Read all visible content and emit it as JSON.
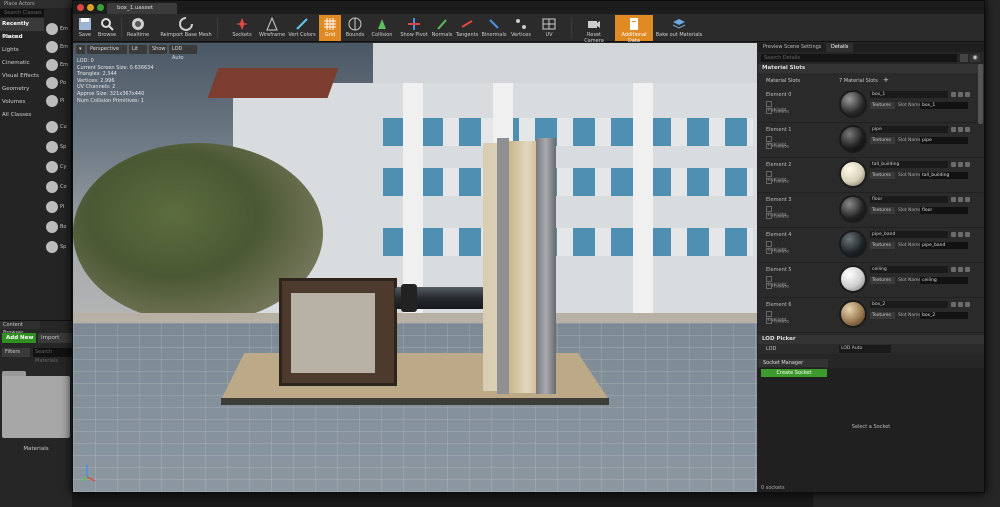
{
  "left": {
    "header": "Place Actors",
    "search_placeholder": "Search Classes",
    "categories": [
      "Recently Placed",
      "Basic",
      "Lights",
      "Cinematic",
      "Visual Effects",
      "Geometry",
      "Volumes",
      "All Classes"
    ],
    "actors": [
      "Em",
      "Em",
      "Em",
      "Po",
      "Pl",
      "Cu",
      "Sp",
      "Cy",
      "Co",
      "Pl",
      "Bo",
      "Sp"
    ]
  },
  "content_browser": {
    "tab": "Content Browser",
    "add_new": "Add New",
    "import": "Import",
    "filters": "Filters",
    "search_placeholder": "Search Materials",
    "folder_label": "Materials"
  },
  "window": {
    "tab_title": "box_1.uasset"
  },
  "toolbar": {
    "items": [
      "Save",
      "Browse",
      "Realtime",
      "Reimport Base Mesh",
      "Sockets",
      "Wireframe",
      "Vert Colors",
      "Grid",
      "Bounds",
      "Collision",
      "Show Pivot",
      "Normals",
      "Tangents",
      "Binormals",
      "Vertices",
      "UV",
      "Reset Camera",
      "Additional Data",
      "Bake out Materials"
    ]
  },
  "viewport": {
    "buttons": [
      "Perspective",
      "Lit",
      "Show",
      "LOD Auto"
    ],
    "stats": [
      "LOD: 0",
      "Current Screen Size: 0.636634",
      "Triangles: 2,344",
      "Vertices: 2,996",
      "UV Channels: 2",
      "Approx Size: 321x367x440",
      "Num Collision Primitives: 1"
    ]
  },
  "details": {
    "tabs": [
      "Preview Scene Settings",
      "Details"
    ],
    "search_placeholder": "Search Details",
    "section_material": "Material Slots",
    "material_slots_label": "Material Slots",
    "material_slots_count": "7 Material Slots",
    "highlight_label": "Highlight",
    "isolate_label": "Isolate",
    "textures_label": "Textures",
    "slot_name_label": "Slot Name",
    "elements": [
      {
        "label": "Element 0",
        "material": "box_1",
        "slot": "box_1",
        "color": "#2a2a2a"
      },
      {
        "label": "Element 1",
        "material": "pipe",
        "slot": "pipe",
        "color": "#1c1c1c"
      },
      {
        "label": "Element 2",
        "material": "tall_building",
        "slot": "tall_building",
        "color": "#d8d1b9"
      },
      {
        "label": "Element 3",
        "material": "floor",
        "slot": "floor",
        "color": "#222222"
      },
      {
        "label": "Element 4",
        "material": "pipe_band",
        "slot": "pipe_band",
        "color": "#1e2326"
      },
      {
        "label": "Element 5",
        "material": "ceiling",
        "slot": "ceiling",
        "color": "#cfcfcf"
      },
      {
        "label": "Element 6",
        "material": "box_2",
        "slot": "box_2",
        "color": "#9b7a52"
      }
    ],
    "section_lod": "LOD Picker",
    "lod_label": "LOD",
    "lod_value": "LOD Auto",
    "socket_tab": "Socket Manager",
    "create_socket": "Create Socket",
    "select_socket": "Select a Socket",
    "socket_count": "0 sockets"
  }
}
